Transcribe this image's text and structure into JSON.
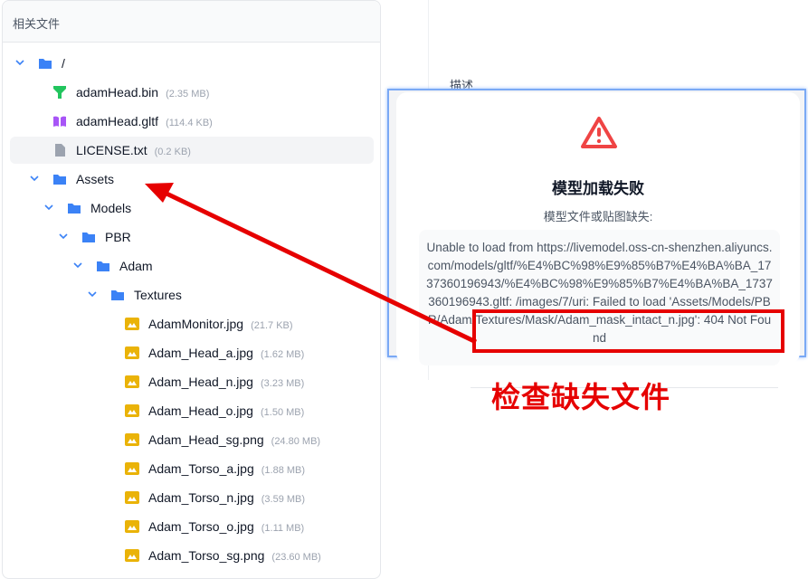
{
  "panel": {
    "title": "相关文件"
  },
  "tree": [
    {
      "level": 0,
      "type": "folder",
      "name": "/",
      "expanded": true
    },
    {
      "level": 1,
      "type": "bin",
      "name": "adamHead.bin",
      "size": "(2.35 MB)"
    },
    {
      "level": 1,
      "type": "gltf",
      "name": "adamHead.gltf",
      "size": "(114.4 KB)"
    },
    {
      "level": 1,
      "type": "file",
      "name": "LICENSE.txt",
      "size": "(0.2 KB)",
      "highlighted": true
    },
    {
      "level": 1,
      "type": "folder",
      "name": "Assets",
      "expanded": true
    },
    {
      "level": 2,
      "type": "folder",
      "name": "Models",
      "expanded": true
    },
    {
      "level": 3,
      "type": "folder",
      "name": "PBR",
      "expanded": true
    },
    {
      "level": 4,
      "type": "folder",
      "name": "Adam",
      "expanded": true
    },
    {
      "level": 5,
      "type": "folder",
      "name": "Textures",
      "expanded": true
    },
    {
      "level": 6,
      "type": "image",
      "name": "AdamMonitor.jpg",
      "size": "(21.7 KB)"
    },
    {
      "level": 6,
      "type": "image",
      "name": "Adam_Head_a.jpg",
      "size": "(1.62 MB)"
    },
    {
      "level": 6,
      "type": "image",
      "name": "Adam_Head_n.jpg",
      "size": "(3.23 MB)"
    },
    {
      "level": 6,
      "type": "image",
      "name": "Adam_Head_o.jpg",
      "size": "(1.50 MB)"
    },
    {
      "level": 6,
      "type": "image",
      "name": "Adam_Head_sg.png",
      "size": "(24.80 MB)"
    },
    {
      "level": 6,
      "type": "image",
      "name": "Adam_Torso_a.jpg",
      "size": "(1.88 MB)"
    },
    {
      "level": 6,
      "type": "image",
      "name": "Adam_Torso_n.jpg",
      "size": "(3.59 MB)"
    },
    {
      "level": 6,
      "type": "image",
      "name": "Adam_Torso_o.jpg",
      "size": "(1.11 MB)"
    },
    {
      "level": 6,
      "type": "image",
      "name": "Adam_Torso_sg.png",
      "size": "(23.60 MB)"
    }
  ],
  "background": {
    "description_label": "描述"
  },
  "modal": {
    "title": "模型加载失败",
    "subtitle": "模型文件或贴图缺失:",
    "error": "Unable to load from https://livemodel.oss-cn-shenzhen.aliyuncs.com/models/gltf/%E4%BC%98%E9%85%B7%E4%BA%BA_1737360196943/%E4%BC%98%E9%85%B7%E4%BA%BA_1737360196943.gltf: /images/7/uri: Failed to load 'Assets/Models/PBR/Adam/Textures/Mask/Adam_mask_intact_n.jpg': 404 Not Found"
  },
  "annotation": {
    "text": "检查缺失文件",
    "color": "#e60000"
  },
  "colors": {
    "folder": "#3b82f6",
    "bin": "#22c55e",
    "gltf": "#a855f7",
    "file": "#9ca3af",
    "image": "#eab308",
    "warning": "#ef4444"
  }
}
